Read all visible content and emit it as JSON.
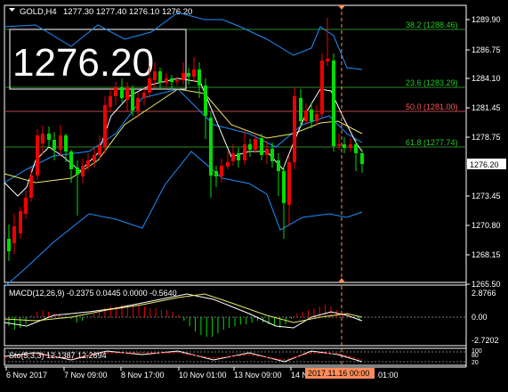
{
  "header": {
    "title": "GOLD,H4",
    "ohlc": "1277.30 1277.40 1276.10 1276.20",
    "big_price": "1276.20"
  },
  "colors": {
    "background": "#000000",
    "frame": "#ffffff",
    "bull": "#00dd00",
    "bear": "#ee0000",
    "bollinger": "#1e90ff",
    "ma_fast": "#ffffff",
    "ma_slow": "#e8e86a",
    "fibo_line": "#2a8a2a",
    "fibo_50": "#b84848",
    "fibo_text": "#22cc22",
    "fibo_50_text": "#ff5555",
    "price_tag_bg": "#ffffff",
    "time_tag_bg": "#ff8c5a"
  },
  "fibonacci": [
    {
      "label": "38.2",
      "value": "(1288.46)",
      "kind": "normal"
    },
    {
      "label": "23.6",
      "value": "(1283.29)",
      "kind": "normal"
    },
    {
      "label": "50.0",
      "value": "(1281.00)",
      "kind": "mid"
    },
    {
      "label": "61.8",
      "value": "(1277.74)",
      "kind": "normal"
    }
  ],
  "price_axis": {
    "ticks": [
      "1289.90",
      "1286.75",
      "1284.10",
      "1281.45",
      "1278.75",
      "1273.45",
      "1270.80",
      "1268.15",
      "1265.50"
    ],
    "current_price": "1276.20"
  },
  "macd": {
    "label": "MACD(12,26,9) -0.2375 0.0445 0.0000 -0.5640",
    "ticks": [
      "2.8766",
      "0.00",
      "-2.7202"
    ]
  },
  "stoch": {
    "label": "Sto(5,3,3) 12.1387 12.2694",
    "ticks": [
      "100",
      "80",
      "20"
    ]
  },
  "time_axis": {
    "labels": [
      "6 Nov 2017",
      "7 Nov 09:00",
      "8 Nov 17:00",
      "10 Nov 01:00",
      "13 Nov 09:00",
      "14 N"
    ],
    "highlight": "2017.11.16 00:00",
    "tail": "01:00"
  }
}
